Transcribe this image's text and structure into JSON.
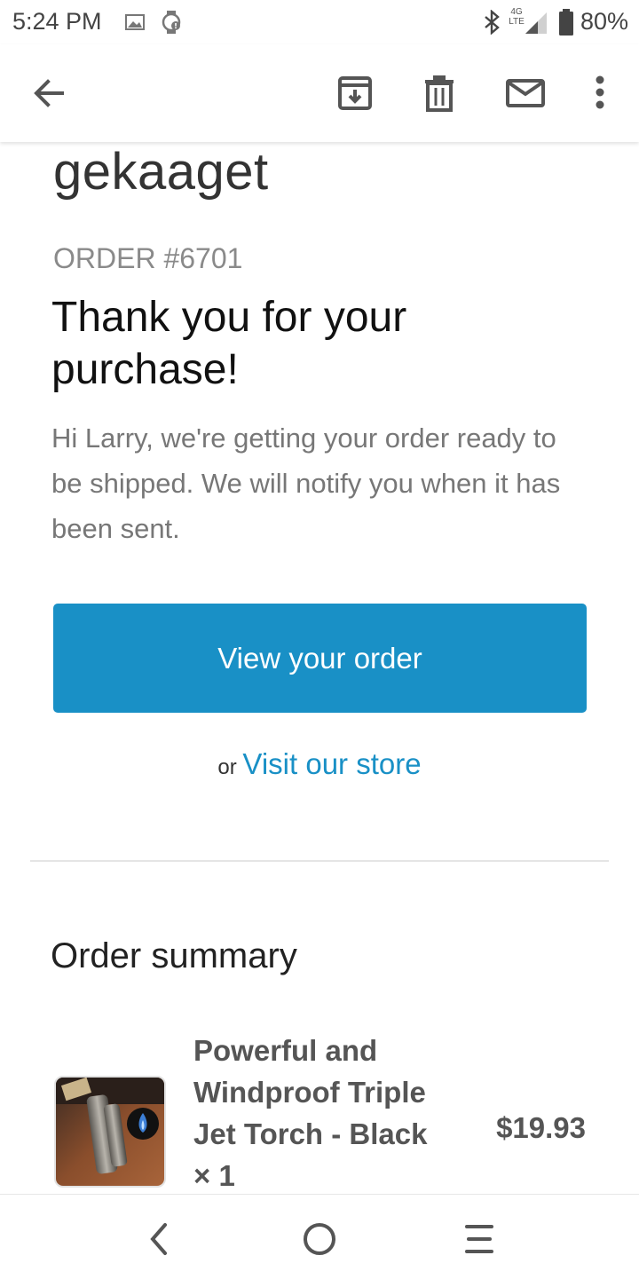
{
  "status_bar": {
    "time": "5:24 PM",
    "network": "4G LTE",
    "battery": "80%",
    "icons": [
      "image-icon",
      "watch-alert-icon",
      "bluetooth-icon",
      "signal-icon",
      "battery-icon"
    ]
  },
  "app_bar": {
    "icons": [
      "back-arrow-icon",
      "archive-icon",
      "trash-icon",
      "mail-icon",
      "more-vert-icon"
    ]
  },
  "email": {
    "store_name": "gekaaget",
    "order_number": "ORDER #6701",
    "thanks_heading": "Thank you for your purchase!",
    "greeting": "Hi Larry, we're getting your order ready to be shipped. We will notify you when it has been sent.",
    "view_order_label": "View your order",
    "or_text": "or",
    "visit_store_label": "Visit our store",
    "summary_title": "Order summary",
    "items": [
      {
        "name": "Powerful and Windproof Triple Jet Torch - Black × 1",
        "price": "$19.93"
      }
    ]
  },
  "colors": {
    "accent": "#1990c6",
    "muted_text": "#777777"
  },
  "nav_bar": {
    "icons": [
      "nav-back-icon",
      "nav-home-icon",
      "nav-recents-icon"
    ]
  }
}
